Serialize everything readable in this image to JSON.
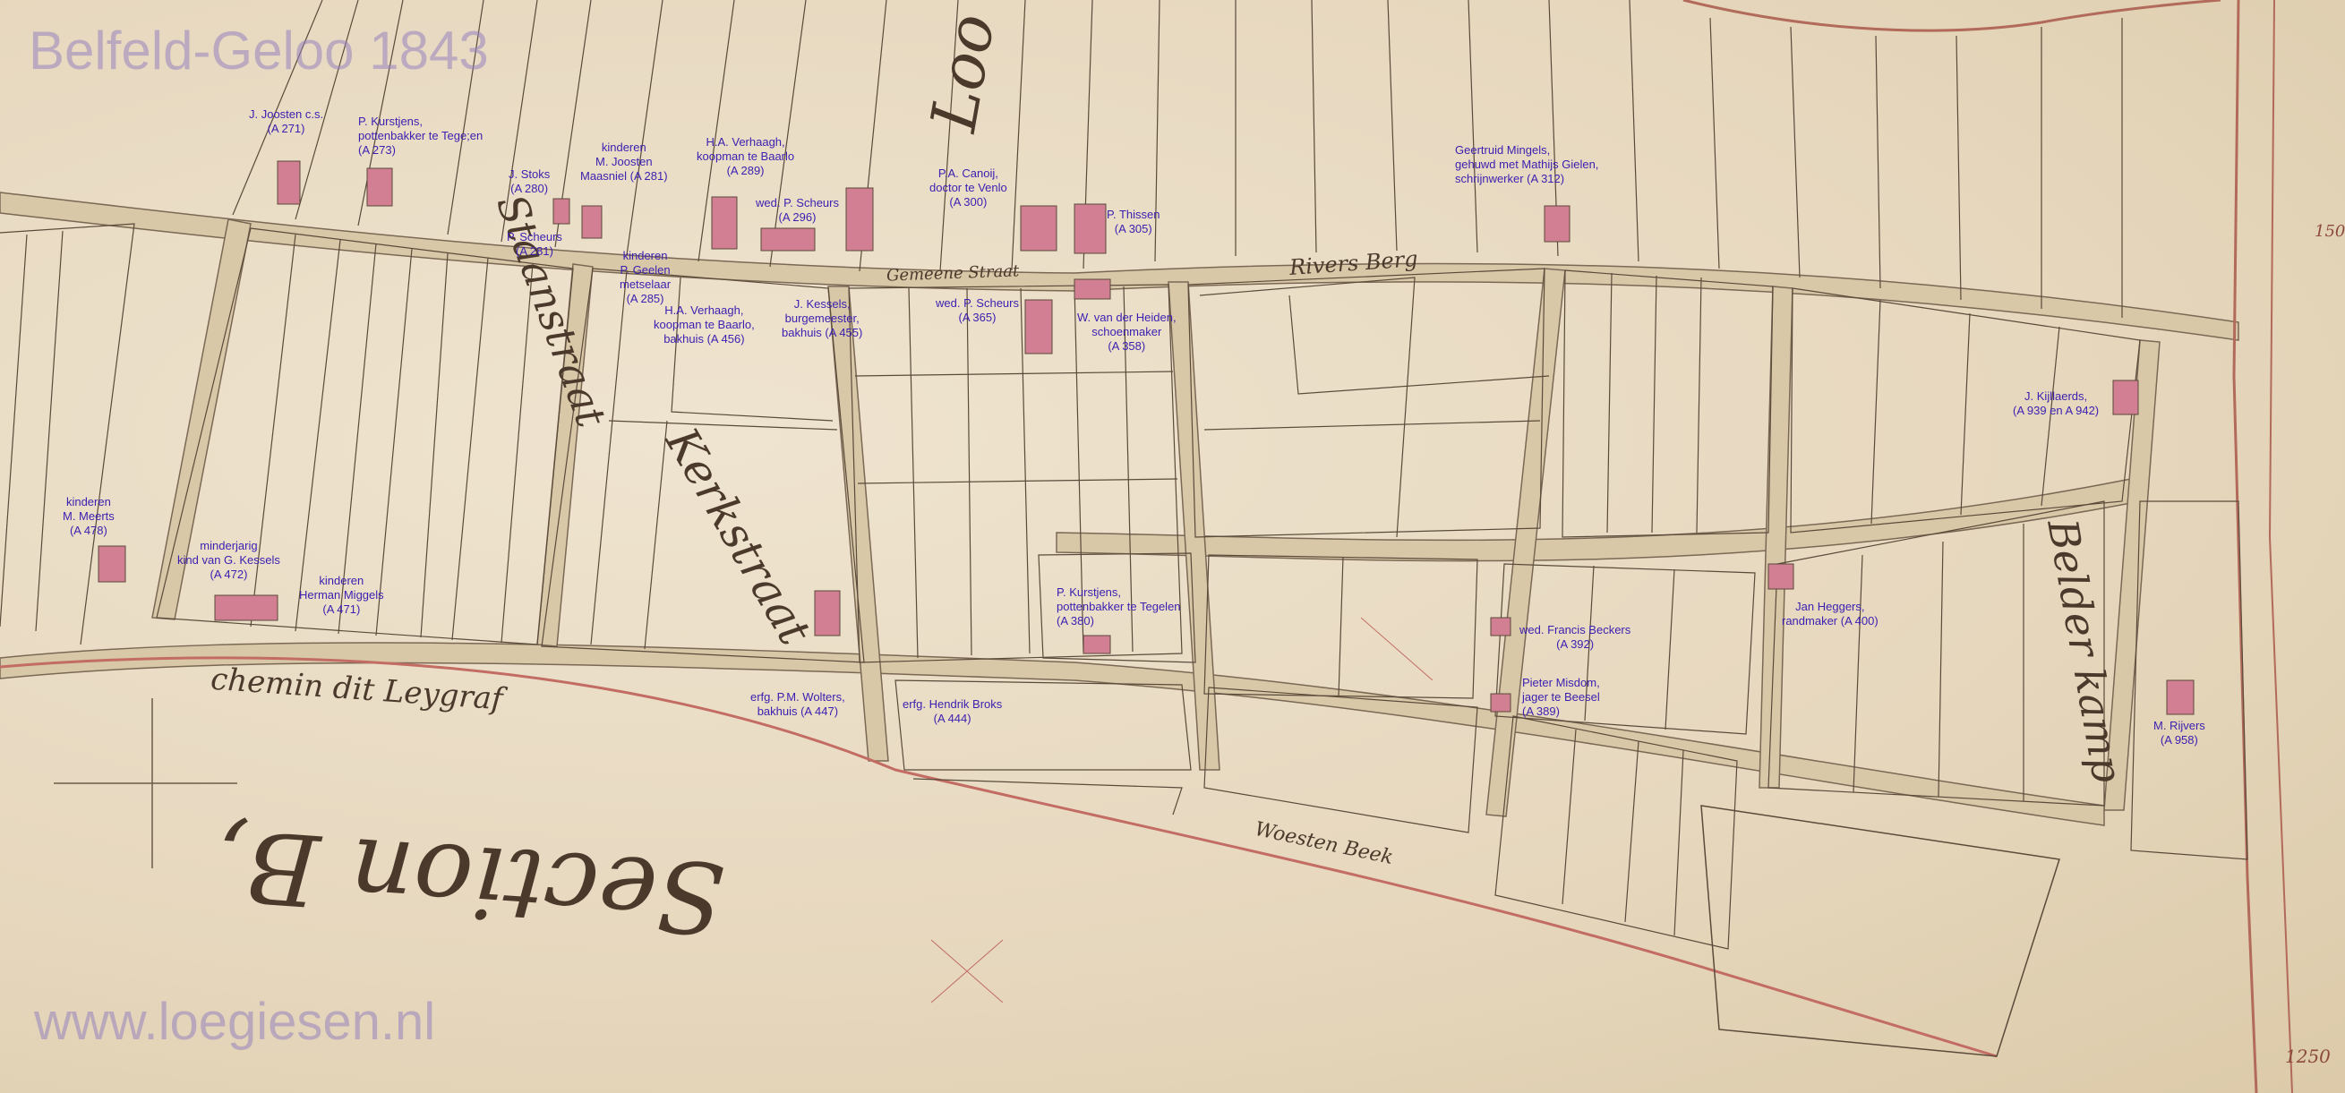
{
  "map_title": "Belfeld-Geloo 1843",
  "website": "www.loegiesen.nl",
  "section_label": "Section B,",
  "road_label": "chemin dit Leygraf",
  "edge_numbers": [
    "150",
    "1250"
  ],
  "colors": {
    "label_text": "#3a1fb0",
    "paper": "#e9dcc6",
    "road": "#d8c7a8",
    "parcel_line": "#5a4a3a",
    "house": "#d27f94",
    "watermark": "#9682be"
  },
  "owners": [
    {
      "id": "o1",
      "text": "J. Joosten c.s.\n(A 271)"
    },
    {
      "id": "o2",
      "text": "P. Kurstjens,\npottenbakker te Tege;en\n(A 273)"
    },
    {
      "id": "o3",
      "text": "kinderen\nM. Joosten\nMaasniel (A 281)"
    },
    {
      "id": "o4",
      "text": "J. Stoks\n(A 280)"
    },
    {
      "id": "o5",
      "text": "P. Scheurs\n(A 281)"
    },
    {
      "id": "o6",
      "text": "H.A. Verhaagh,\nkoopman te Baarlo\n(A 289)"
    },
    {
      "id": "o7",
      "text": "wed. P. Scheurs\n(A 296)"
    },
    {
      "id": "o8",
      "text": "P.A. Canoij,\ndoctor te Venlo\n(A 300)"
    },
    {
      "id": "o9",
      "text": "P. Thissen\n(A 305)"
    },
    {
      "id": "o10",
      "text": "Geertruid Mingels,\ngehuwd met Mathijs Gielen,\nschrijnwerker (A 312)"
    },
    {
      "id": "o11",
      "text": "kinderen\nP. Geelen\nmetselaar\n(A 285)"
    },
    {
      "id": "o12",
      "text": "H.A. Verhaagh,\nkoopman te Baarlo,\nbakhuis (A 456)"
    },
    {
      "id": "o13",
      "text": "J. Kessels,\nburgemeester,\nbakhuis (A 455)"
    },
    {
      "id": "o14",
      "text": "wed. P. Scheurs\n(A 365)"
    },
    {
      "id": "o15",
      "text": "W. van der Heiden,\nschoenmaker\n(A 358)"
    },
    {
      "id": "o16",
      "text": "J. Kijllaerds,\n(A 939 en A 942)"
    },
    {
      "id": "o17",
      "text": "kinderen\nM. Meerts\n(A 478)"
    },
    {
      "id": "o18",
      "text": "minderjarig\nkind van G. Kessels\n(A 472)"
    },
    {
      "id": "o19",
      "text": "kinderen\nHerman Miggels\n(A 471)"
    },
    {
      "id": "o20",
      "text": "P. Kurstjens,\npottenbakker te Tegelen\n(A 380)"
    },
    {
      "id": "o21",
      "text": "wed. Francis Beckers\n(A 392)"
    },
    {
      "id": "o22",
      "text": "Pieter Misdom,\njager te Beesel\n(A 389)"
    },
    {
      "id": "o23",
      "text": "Jan Heggers,\nrandmaker (A 400)"
    },
    {
      "id": "o24",
      "text": "erfg. P.M. Wolters,\nbakhuis (A 447)"
    },
    {
      "id": "o25",
      "text": "erfg. Hendrik Broks\n(A 444)"
    },
    {
      "id": "o26",
      "text": "M. Rijvers\n(A 958)"
    }
  ]
}
